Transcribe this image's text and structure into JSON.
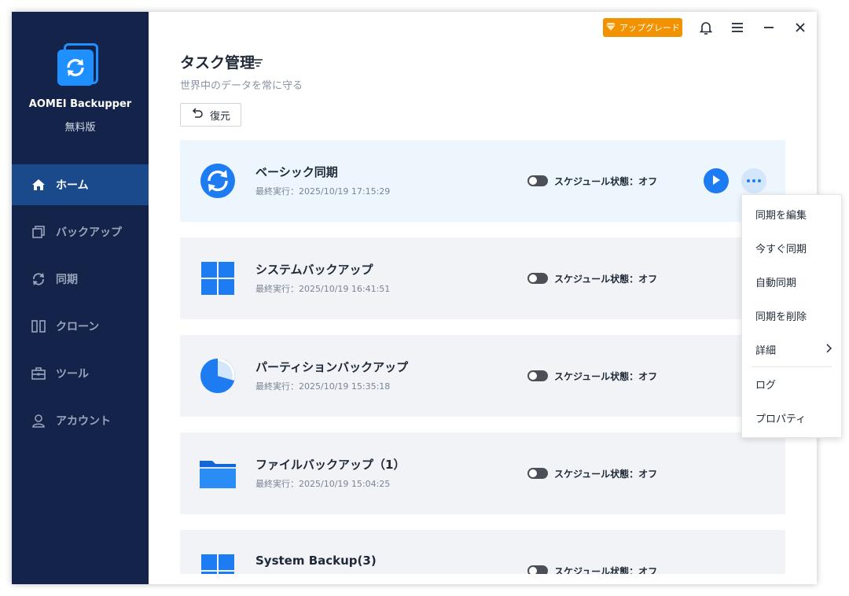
{
  "app": {
    "name": "AOMEI Backupper",
    "edition": "無料版"
  },
  "titlebar": {
    "upgrade_label": "アップグレード"
  },
  "sidebar": {
    "items": [
      {
        "label": "ホーム",
        "icon": "home-icon",
        "active": true
      },
      {
        "label": "バックアップ",
        "icon": "backup-icon",
        "active": false
      },
      {
        "label": "同期",
        "icon": "sync-icon",
        "active": false
      },
      {
        "label": "クローン",
        "icon": "clone-icon",
        "active": false
      },
      {
        "label": "ツール",
        "icon": "toolbox-icon",
        "active": false
      },
      {
        "label": "アカウント",
        "icon": "user-icon",
        "active": false
      }
    ]
  },
  "main": {
    "title": "タスク管理",
    "subtitle": "世界中のデータを常に守る",
    "restore_label": "復元",
    "schedule_label": "スケジュール状態：オフ",
    "tasks": [
      {
        "name": "ベーシック同期",
        "last_run": "最終実行：2025/10/19 17:15:29",
        "icon": "sync-circle-icon"
      },
      {
        "name": "システムバックアップ",
        "last_run": "最終実行：2025/10/19 16:41:51",
        "icon": "windows-icon"
      },
      {
        "name": "パーティションバックアップ",
        "last_run": "最終実行：2025/10/19 15:35:18",
        "icon": "pie-chart-icon"
      },
      {
        "name": "ファイルバックアップ（1）",
        "last_run": "最終実行：2025/10/19 15:04:25",
        "icon": "folder-icon"
      },
      {
        "name": "System Backup(3)",
        "last_run": "",
        "icon": "windows-icon"
      }
    ]
  },
  "context_menu": {
    "items": [
      "同期を編集",
      "今すぐ同期",
      "自動同期",
      "同期を削除",
      "詳細"
    ],
    "items_after_separator": [
      "ログ",
      "プロパティ"
    ]
  },
  "colors": {
    "sidebar_bg": "#14234a",
    "active_nav": "#1b4a8c",
    "accent": "#1e7cf2",
    "upgrade": "#f39200"
  }
}
